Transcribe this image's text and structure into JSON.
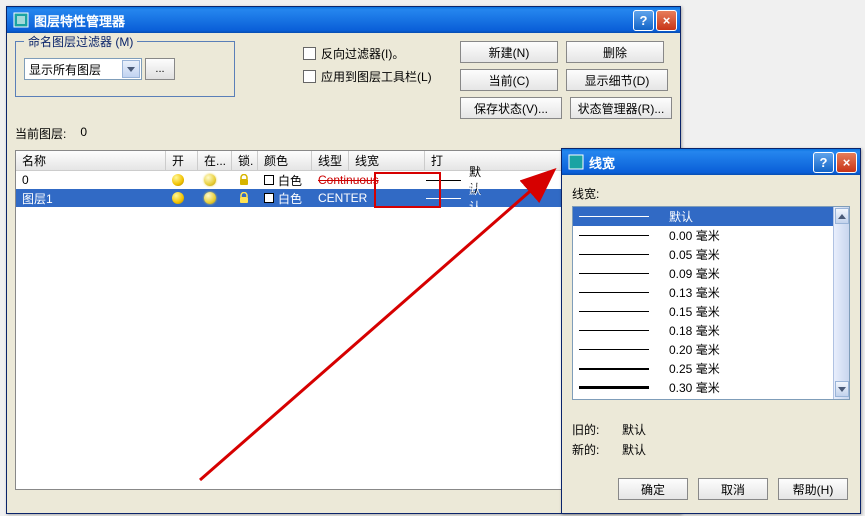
{
  "main_window": {
    "title": "图层特性管理器",
    "filter_legend": "命名图层过滤器 (M)",
    "filter_combo": "显示所有图层",
    "filter_browse": "...",
    "chk_invert": "反向过滤器(I)。",
    "chk_apply_toolbar": "应用到图层工具栏(L)",
    "btn_new": "新建(N)",
    "btn_delete": "删除",
    "btn_current": "当前(C)",
    "btn_details": "显示细节(D)",
    "btn_savestate": "保存状态(V)...",
    "btn_statemgr": "状态管理器(R)...",
    "current_layer_label": "当前图层:",
    "current_layer_value": "0",
    "columns": {
      "name": "名称",
      "on": "开",
      "freeze": "在...",
      "lock": "锁.",
      "color": "颜色",
      "linetype": "线型",
      "lineweight": "线宽",
      "plot": "打",
      "rest": ""
    },
    "rows": [
      {
        "name": "0",
        "color_name": "白色",
        "linetype": "Continuous",
        "lw_label": "默认"
      },
      {
        "name": "图层1",
        "color_name": "白色",
        "linetype": "CENTER",
        "lw_label": "默认"
      }
    ]
  },
  "lw_dialog": {
    "title": "线宽",
    "label": "线宽:",
    "items": [
      {
        "label": "默认",
        "thick": 1,
        "sel": true
      },
      {
        "label": "0.00 毫米",
        "thick": 1
      },
      {
        "label": "0.05 毫米",
        "thick": 1
      },
      {
        "label": "0.09 毫米",
        "thick": 1
      },
      {
        "label": "0.13 毫米",
        "thick": 1
      },
      {
        "label": "0.15 毫米",
        "thick": 1
      },
      {
        "label": "0.18 毫米",
        "thick": 1
      },
      {
        "label": "0.20 毫米",
        "thick": 1
      },
      {
        "label": "0.25 毫米",
        "thick": 2
      },
      {
        "label": "0.30 毫米",
        "thick": 3
      }
    ],
    "old_label": "旧的:",
    "old_value": "默认",
    "new_label": "新的:",
    "new_value": "默认",
    "btn_ok": "确定",
    "btn_cancel": "取消",
    "btn_help": "帮助(H)"
  },
  "icons": {
    "app": "⊞",
    "help": "?",
    "close": "×"
  }
}
